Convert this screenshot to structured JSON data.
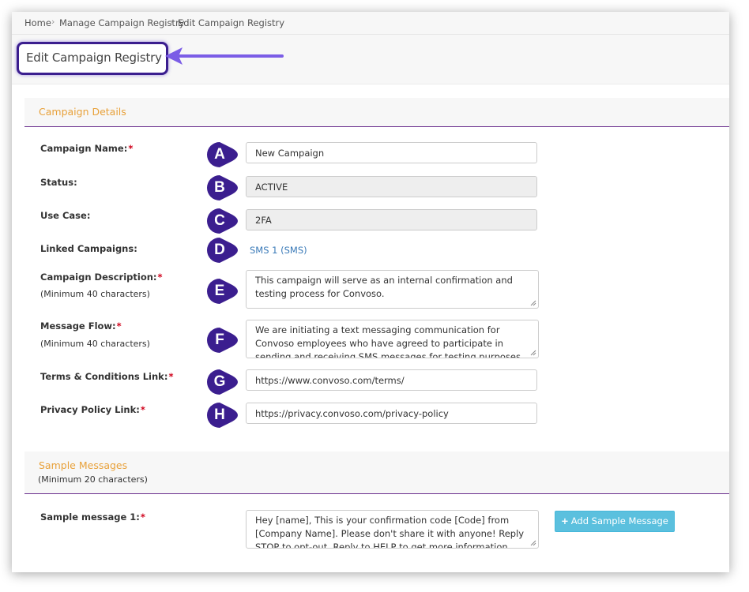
{
  "breadcrumb": {
    "items": [
      "Home",
      "Manage Campaign Registry",
      "Edit Campaign Registry"
    ],
    "separator": "›"
  },
  "page": {
    "title": "Edit Campaign Registry"
  },
  "campaign_details": {
    "title": "Campaign Details",
    "fields": {
      "campaign_name": {
        "label": "Campaign Name:",
        "required_mark": "*",
        "value": "New Campaign",
        "marker": "A"
      },
      "status": {
        "label": "Status:",
        "value": "ACTIVE",
        "marker": "B"
      },
      "use_case": {
        "label": "Use Case:",
        "value": "2FA",
        "marker": "C"
      },
      "linked_campaigns": {
        "label": "Linked Campaigns:",
        "value": "SMS 1 (SMS)",
        "marker": "D"
      },
      "campaign_description": {
        "label": "Campaign Description:",
        "required_mark": "*",
        "sublabel": "(Minimum 40 characters)",
        "value": "This campaign will serve as an internal confirmation and testing process for Convoso.",
        "marker": "E"
      },
      "message_flow": {
        "label": "Message Flow:",
        "required_mark": "*",
        "sublabel": "(Minimum 40 characters)",
        "value": "We are initiating a text messaging communication for Convoso employees who have agreed to participate in sending and receiving SMS messages for testing purposes. This consent is",
        "marker": "F"
      },
      "terms_link": {
        "label": "Terms & Conditions Link:",
        "required_mark": "*",
        "value": "https://www.convoso.com/terms/",
        "marker": "G"
      },
      "privacy_link": {
        "label": "Privacy Policy Link:",
        "required_mark": "*",
        "value": "https://privacy.convoso.com/privacy-policy",
        "marker": "H"
      }
    }
  },
  "sample_messages": {
    "title": "Sample Messages",
    "subtitle": "(Minimum 20 characters)",
    "message_1": {
      "label": "Sample message 1:",
      "required_mark": "*",
      "value": "Hey [name], This is your confirmation code [Code] from [Company Name]. Please don't share it with anyone! Reply STOP to opt-out. Reply to HELP to get more information."
    },
    "add_button": {
      "icon": "plus-icon",
      "label": "Add Sample Message"
    }
  },
  "colors": {
    "marker_fill": "#3b1e8f",
    "section_title": "#e8a13a",
    "section_rule": "#6b2f8e",
    "link": "#3a7ab8",
    "required": "#d0021b",
    "button": "#5bc0de",
    "arrow": "#7b5de6"
  }
}
